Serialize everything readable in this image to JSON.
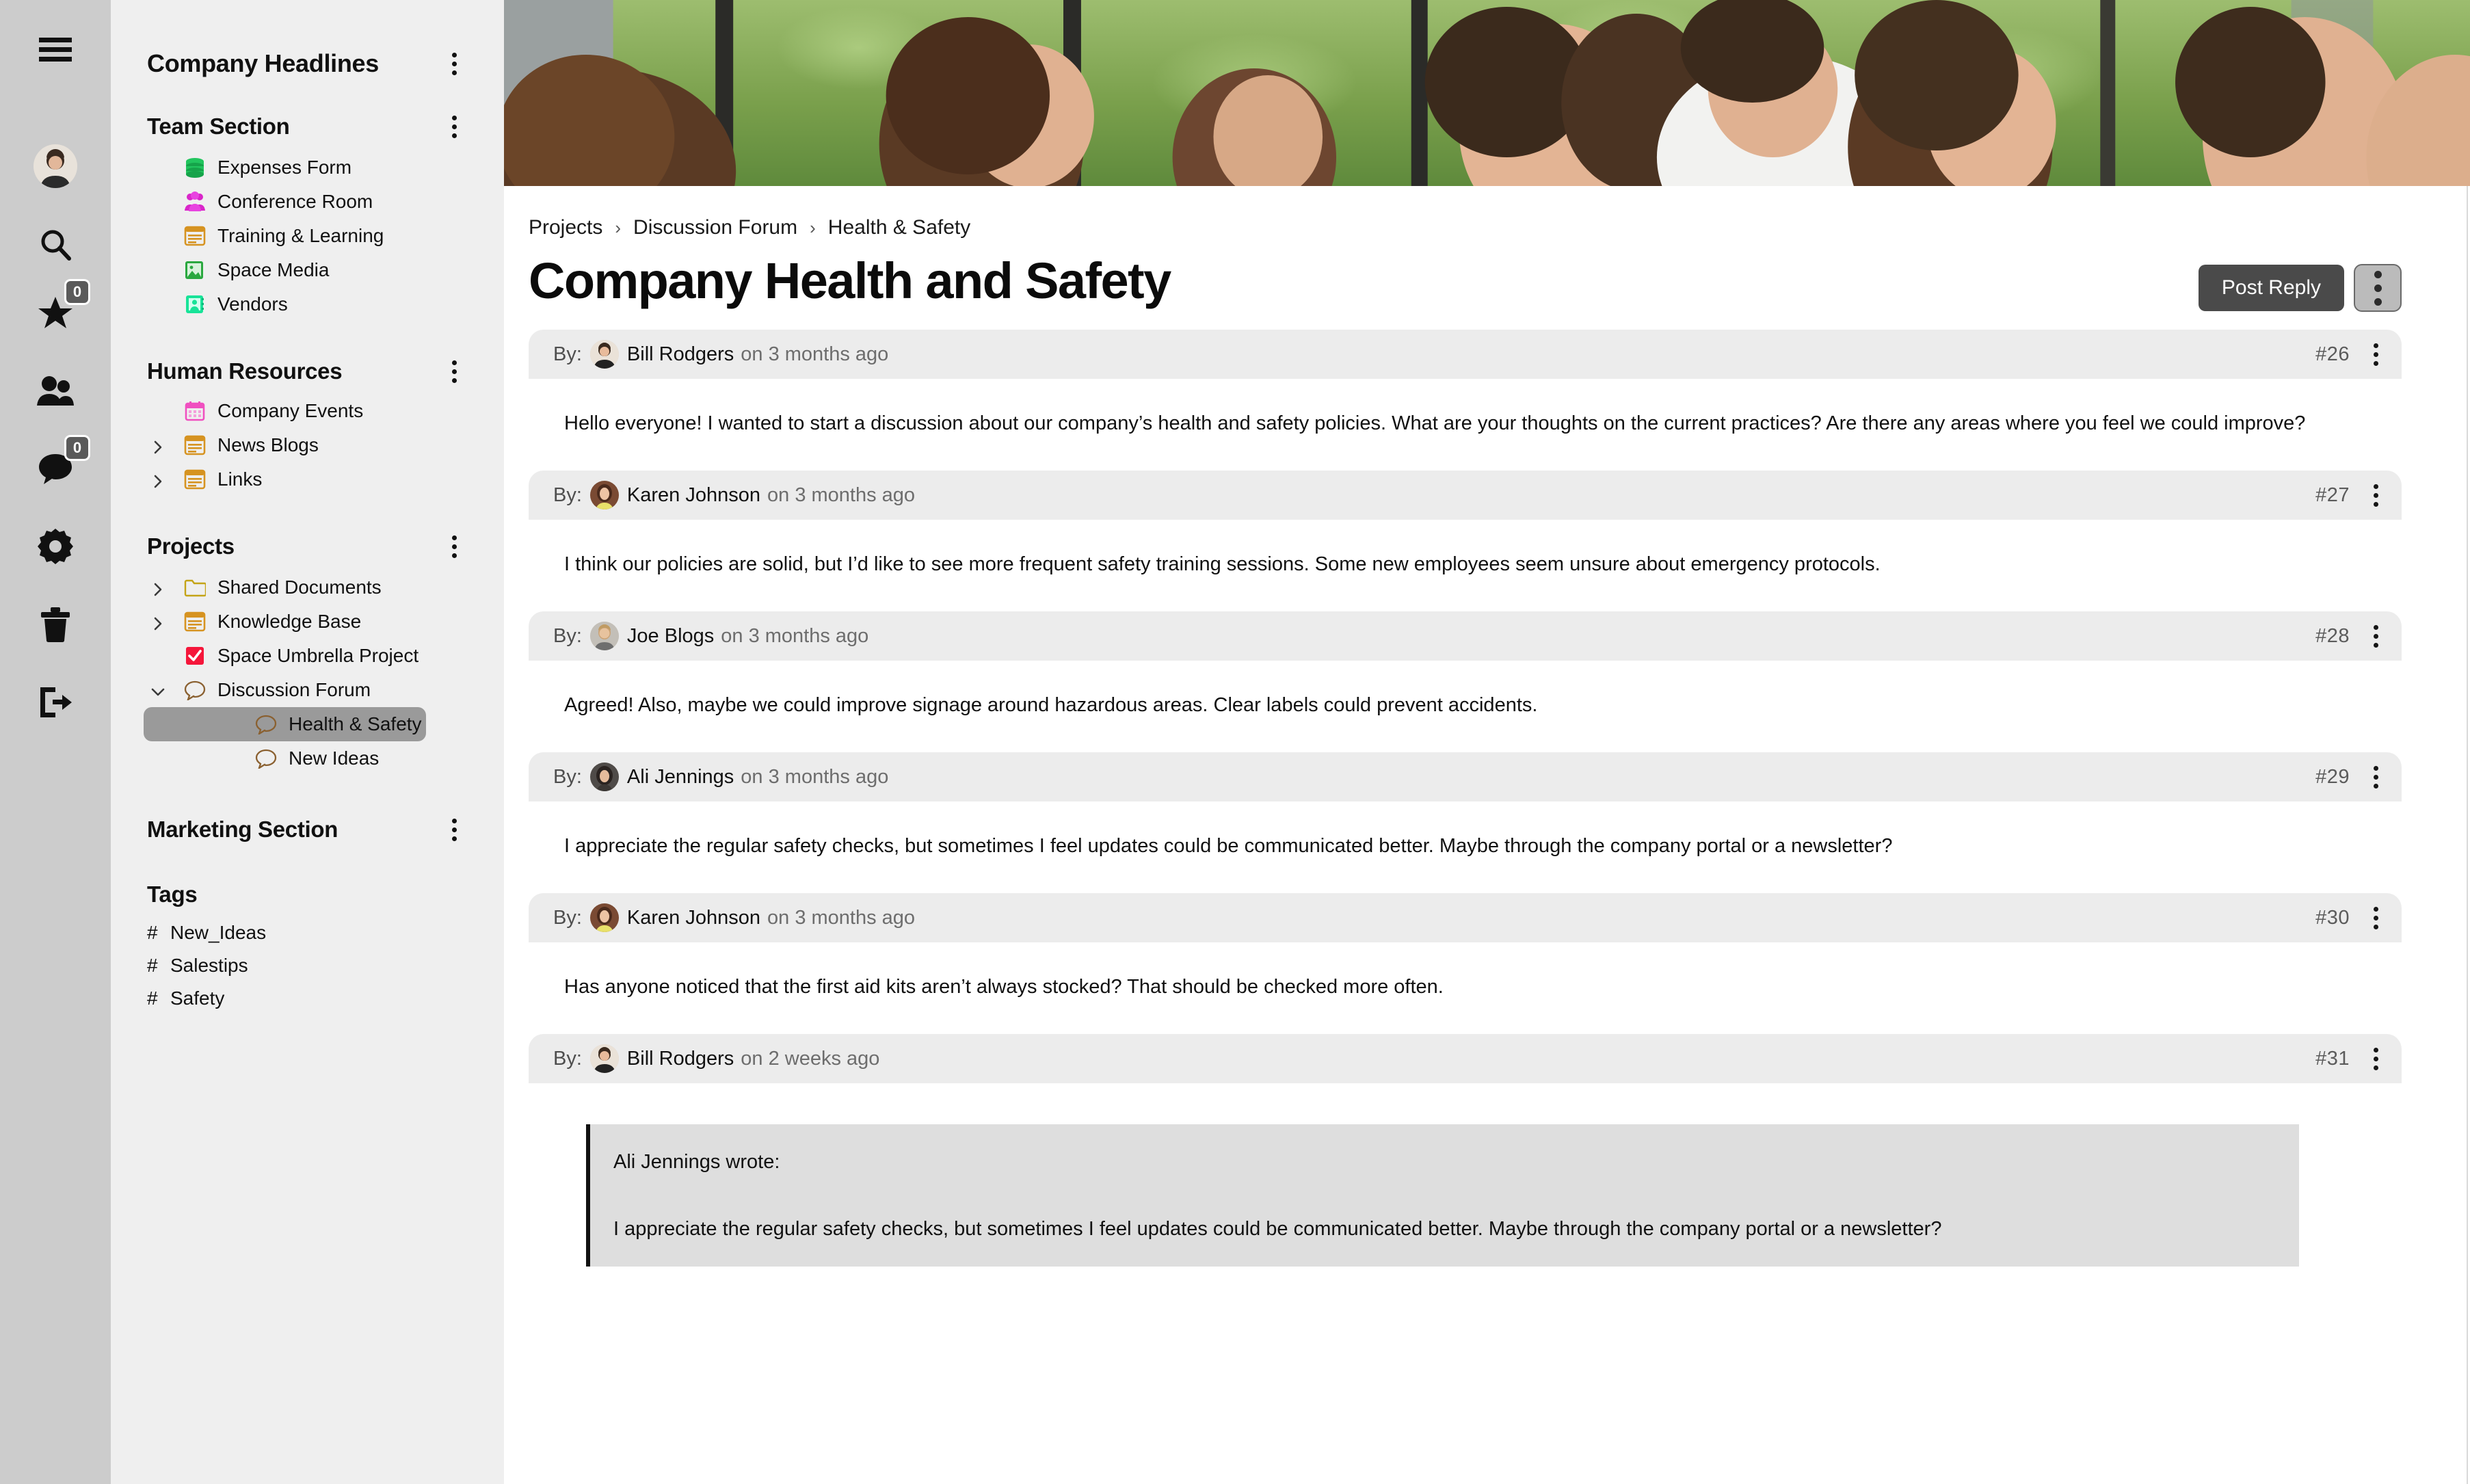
{
  "rail": {
    "menu_icon": "hamburger-icon",
    "avatar": "user-avatar",
    "search_icon": "search-icon",
    "favorites_icon": "star-icon",
    "favorites_badge": "0",
    "people_icon": "people-icon",
    "messages_icon": "chat-bubble-icon",
    "messages_badge": "0",
    "settings_icon": "gear-icon",
    "trash_icon": "trash-icon",
    "logout_icon": "logout-icon"
  },
  "nav": {
    "headline": "Company Headlines",
    "sections": [
      {
        "title": "Team Section",
        "items": [
          {
            "label": "Expenses Form",
            "icon": "database-icon",
            "color": "#22c55e",
            "expandable": false,
            "level": 1
          },
          {
            "label": "Conference Room",
            "icon": "group-icon",
            "color": "#d926c9",
            "expandable": false,
            "level": 1
          },
          {
            "label": "Training & Learning",
            "icon": "article-icon",
            "color": "#d69321",
            "expandable": false,
            "level": 1
          },
          {
            "label": "Space Media",
            "icon": "image-icon",
            "color": "#2aa83f",
            "expandable": false,
            "level": 1
          },
          {
            "label": "Vendors",
            "icon": "contact-card-icon",
            "color": "#18e398",
            "expandable": false,
            "level": 1
          }
        ]
      },
      {
        "title": "Human Resources",
        "items": [
          {
            "label": "Company Events",
            "icon": "calendar-icon",
            "color": "#f050c0",
            "expandable": false,
            "level": 1
          },
          {
            "label": "News Blogs",
            "icon": "article-icon",
            "color": "#d69321",
            "expandable": true,
            "level": 1
          },
          {
            "label": "Links",
            "icon": "article-icon",
            "color": "#d69321",
            "expandable": true,
            "level": 1
          }
        ]
      },
      {
        "title": "Projects",
        "items": [
          {
            "label": "Shared Documents",
            "icon": "folder-icon",
            "color": "#c4a417",
            "expandable": true,
            "level": 1
          },
          {
            "label": "Knowledge Base",
            "icon": "article-icon",
            "color": "#d69321",
            "expandable": true,
            "level": 1
          },
          {
            "label": "Space Umbrella Project",
            "icon": "checkbox-icon",
            "color": "#f5163a",
            "expandable": false,
            "level": 1
          },
          {
            "label": "Discussion Forum",
            "icon": "speech-bubble-icon",
            "color": "#8a6030",
            "expandable": true,
            "expanded": true,
            "level": 1
          },
          {
            "label": "Health & Safety",
            "icon": "speech-bubble-icon",
            "color": "#8a6030",
            "expandable": false,
            "level": 2,
            "active": true
          },
          {
            "label": "New Ideas",
            "icon": "speech-bubble-icon",
            "color": "#8a6030",
            "expandable": false,
            "level": 2
          }
        ]
      },
      {
        "title": "Marketing Section",
        "items": []
      }
    ],
    "tags_title": "Tags",
    "tags": [
      "New_Ideas",
      "Salestips",
      "Safety"
    ]
  },
  "main": {
    "breadcrumb": [
      "Projects",
      "Discussion Forum",
      "Health & Safety"
    ],
    "breadcrumb_separator": "›",
    "title": "Company Health and Safety",
    "post_reply_label": "Post Reply",
    "posts": [
      {
        "by_label": "By:",
        "author": "Bill Rodgers",
        "when": "on 3 months ago",
        "number": "#26",
        "body": "Hello everyone! I wanted to start a discussion about our company’s health and safety policies. What are your thoughts on the current practices? Are there any areas where you feel we could improve?",
        "avatar_tone": "#e6d7cb"
      },
      {
        "by_label": "By:",
        "author": "Karen Johnson",
        "when": "on 3 months ago",
        "number": "#27",
        "body": "I think our policies are solid, but I’d like to see more frequent safety training sessions. Some new employees seem unsure about emergency protocols.",
        "avatar_tone": "#7a4a33"
      },
      {
        "by_label": "By:",
        "author": "Joe Blogs",
        "when": "on 3 months ago",
        "number": "#28",
        "body": "Agreed! Also, maybe we could improve signage around hazardous areas. Clear labels could prevent accidents.",
        "avatar_tone": "#b9b5ae"
      },
      {
        "by_label": "By:",
        "author": "Ali Jennings",
        "when": "on 3 months ago",
        "number": "#29",
        "body": "I appreciate the regular safety checks, but sometimes I feel updates could be communicated better. Maybe through the company portal or a newsletter?",
        "avatar_tone": "#55514e"
      },
      {
        "by_label": "By:",
        "author": "Karen Johnson",
        "when": "on 3 months ago",
        "number": "#30",
        "body": "Has anyone noticed that the first aid kits aren’t always stocked? That should be checked more often.",
        "avatar_tone": "#7a4a33"
      },
      {
        "by_label": "By:",
        "author": "Bill Rodgers",
        "when": "on 2 weeks ago",
        "number": "#31",
        "quote_author": "Ali Jennings wrote:",
        "quote_body": "I appreciate the regular safety checks, but sometimes I feel updates could be communicated better. Maybe through the company portal or a newsletter?",
        "avatar_tone": "#e6d7cb"
      }
    ]
  },
  "colors": {
    "rail_bg": "#cccccc",
    "nav_bg": "#efefef",
    "post_head_bg": "#ececec",
    "active_item_bg": "#9a9a9a",
    "primary_button_bg": "#4a4a4a",
    "quote_bg": "#dedede"
  }
}
